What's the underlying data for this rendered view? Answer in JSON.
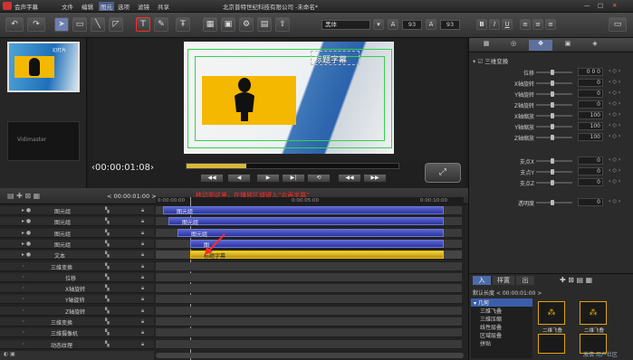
{
  "app": {
    "title": "北京普特世纪科技有限公司 -未命名*",
    "name": "会声字幕"
  },
  "menu": [
    "文件",
    "编辑",
    "图元",
    "选项",
    "滤镜",
    "共享"
  ],
  "toolbar": {
    "font": "黑体",
    "size1": "93",
    "size2": "93"
  },
  "preview": {
    "title_text": "标题字幕",
    "timecode": "00:00:01:08"
  },
  "thumbnails": [
    {
      "label": "幻灯片"
    },
    {
      "label": "Vidimaster"
    }
  ],
  "timeline": {
    "timecode_box": "< 00:00:01:00 >",
    "ticks": [
      "0:00:00:00",
      "0:00:05:00",
      "0:00:10:00"
    ],
    "annotation": "移动到这里，在播放区域键入\"会声字幕\"",
    "rows": [
      {
        "label": "图元组",
        "clip": "图元组"
      },
      {
        "label": "图元组",
        "clip": "图元组"
      },
      {
        "label": "图元组",
        "clip": "图元组"
      },
      {
        "label": "图元组",
        "clip": "图"
      },
      {
        "label": "文本",
        "clip": "标题字幕"
      },
      {
        "label": "三维变换",
        "clip": ""
      },
      {
        "label": "位移",
        "clip": ""
      },
      {
        "label": "X轴旋转",
        "clip": ""
      },
      {
        "label": "Y轴旋转",
        "clip": ""
      },
      {
        "label": "Z轴旋转",
        "clip": ""
      },
      {
        "label": "三维变换",
        "clip": ""
      },
      {
        "label": "三维摄像机",
        "clip": ""
      },
      {
        "label": "动态纹理",
        "clip": ""
      }
    ]
  },
  "props": {
    "section": "三维变换",
    "rows": [
      {
        "label": "位移",
        "value": "0 0 0"
      },
      {
        "label": "X轴旋转",
        "value": "0"
      },
      {
        "label": "Y轴旋转",
        "value": "0"
      },
      {
        "label": "Z轴旋转",
        "value": "0"
      },
      {
        "label": "X轴缩放",
        "value": "100"
      },
      {
        "label": "Y轴缩放",
        "value": "100"
      },
      {
        "label": "Z轴缩放",
        "value": "100"
      },
      {
        "label": "支点X",
        "value": "0"
      },
      {
        "label": "支点Y",
        "value": "0"
      },
      {
        "label": "支点Z",
        "value": "0"
      },
      {
        "label": "透明度",
        "value": "0"
      }
    ]
  },
  "library": {
    "tabs": [
      "入",
      "样置",
      "出"
    ],
    "duration_label": "默认长度 < 00:00:01:00 >",
    "category": "几何",
    "items": [
      "三维飞叠",
      "三维压缩",
      "线性层叠",
      "区域层叠",
      "拼贴"
    ],
    "effects": [
      "二维飞叠",
      "二维飞叠"
    ],
    "watermark": "激情 用户社区"
  },
  "colors": {
    "accent": "#f5b800",
    "clip": "#3a45b8",
    "annotation_red": "#ff2a2a"
  }
}
